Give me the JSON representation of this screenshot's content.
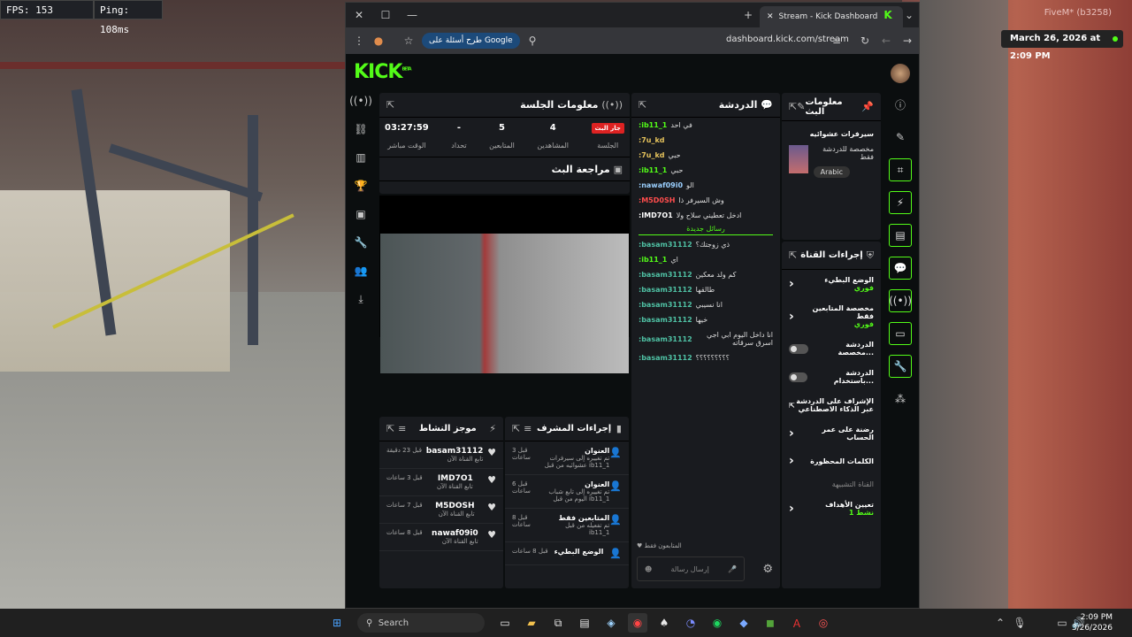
{
  "hud": {
    "fps": "FPS: 153",
    "ping": "Ping: 108ms",
    "fivem": "FiveM* (b3258)",
    "date": "March 26, 2026 at 2:09 PM"
  },
  "browser": {
    "tab_title": "Stream - Kick Dashboard",
    "google_chip": "طرح أسئلة على Google",
    "url": "dashboard.kick.com/stream"
  },
  "app": {
    "logo": "KICK",
    "logo_sup": "BETA"
  },
  "session": {
    "title": "معلومات الجلسة",
    "badge": "جار البث",
    "badge_label": "الجلسة",
    "viewers": "4",
    "viewers_label": "المشاهدين",
    "followers": "5",
    "followers_label": "المتابعين",
    "challenge": "-",
    "challenge_label": "تحداد",
    "uptime": "03:27:59",
    "uptime_label": "الوقت مباشر"
  },
  "review": {
    "title": "مراجعة البث"
  },
  "chat": {
    "title": "الدردشة",
    "new_messages": "رسائل جديدة",
    "followers_only": "المتابعون فقط",
    "input_placeholder": "إرسال رسالة",
    "messages": [
      {
        "user": "ib11_1:",
        "text": "في احد",
        "color": "#53fc18"
      },
      {
        "user": "7u_kd:",
        "text": "",
        "color": "#e6c35c"
      },
      {
        "user": "7u_kd:",
        "text": "حبي",
        "color": "#e6c35c"
      },
      {
        "user": "ib11_1:",
        "text": "حبي",
        "color": "#53fc18"
      },
      {
        "user": "nawaf09i0:",
        "text": "الو",
        "color": "#9bd0ff"
      },
      {
        "user": "M5D0SH:",
        "text": "وش السيرفر ذا",
        "color": "#ff4d4d"
      },
      {
        "user": "IMD7O1:",
        "text": "ادخل تعطيني سلاح ولا",
        "color": "#fff"
      },
      {
        "user": "basam31112:",
        "text": "ذي زوجتك؟",
        "color": "#4fc1a4"
      },
      {
        "user": "ib11_1:",
        "text": "اي",
        "color": "#53fc18"
      },
      {
        "user": "basam31112:",
        "text": "كم ولد معكين",
        "color": "#4fc1a4"
      },
      {
        "user": "basam31112:",
        "text": "طالقها",
        "color": "#4fc1a4"
      },
      {
        "user": "basam31112:",
        "text": "انا نسيبي",
        "color": "#4fc1a4"
      },
      {
        "user": "basam31112:",
        "text": "خيها",
        "color": "#4fc1a4"
      },
      {
        "user": "basam31112:",
        "text": "انا داخل اليوم ابي اجي اسرق سرقاته",
        "color": "#4fc1a4"
      },
      {
        "user": "basam31112:",
        "text": "؟؟؟؟؟؟؟؟؟",
        "color": "#4fc1a4"
      }
    ]
  },
  "stream_info": {
    "title": "معلومات البث",
    "category": "سيرفرات عشوائيه",
    "desc": "مخصصة للدردشة فقط",
    "language": "Arabic"
  },
  "channel_actions": {
    "title": "إجراءات القناة",
    "items": [
      {
        "label": "الوضع البطيء",
        "sub": "فوري",
        "type": "arrow"
      },
      {
        "label": "مخصصة المتابعين فقط",
        "sub": "فوري",
        "type": "arrow"
      },
      {
        "label": "الدردشة مخصصة...",
        "sub": "",
        "type": "toggle"
      },
      {
        "label": "الدردشة باستخدام...",
        "sub": "",
        "type": "toggle"
      },
      {
        "label": "الإشراف على الدردشة عبر الذكاء الاصطناعي",
        "sub": "",
        "type": "ext"
      },
      {
        "label": "رضنة على عمر الحساب",
        "sub": "",
        "type": "arrow"
      },
      {
        "label": "الكلمات المحظورة",
        "sub": "",
        "type": "arrow"
      },
      {
        "label": "القناة التشبيهة",
        "sub": "",
        "type": "muted"
      },
      {
        "label": "تعيين الأهداف",
        "sub": "1 نشط",
        "type": "arrow"
      }
    ]
  },
  "activity": {
    "title": "موجز النشاط",
    "items": [
      {
        "user": "basam31112",
        "sub": "تابع القناة الآن",
        "time": "قبل 23 دقيقة"
      },
      {
        "user": "IMD7O1",
        "sub": "تابع القناة الآن",
        "time": "قبل 3 ساعات"
      },
      {
        "user": "M5DOSH",
        "sub": "تابع القناة الآن",
        "time": "قبل 7 ساعات"
      },
      {
        "user": "nawaf09i0",
        "sub": "تابع القناة الآن",
        "time": "قبل 8 ساعات"
      }
    ]
  },
  "mod_actions": {
    "title": "إجراءات المشرف",
    "items": [
      {
        "name": "العنوان",
        "sub": "تم تغييره إلى سيرفرات عشوائيه من قبل ib11_1",
        "time": "قبل 3 ساعات"
      },
      {
        "name": "العنوان",
        "sub": "تم تغييره إلى تابع شباب اليوم من قبل ib11_1",
        "time": "قبل 6 ساعات"
      },
      {
        "name": "المتابعين فقط",
        "sub": "تم تفعيله من قبل ib11_1",
        "time": "قبل 8 ساعات"
      },
      {
        "name": "الوضع البطيء",
        "sub": "",
        "time": "قبل 8 ساعات"
      }
    ]
  },
  "taskbar": {
    "search": "Search",
    "time": "2:09 PM",
    "date": "3/26/2026"
  }
}
